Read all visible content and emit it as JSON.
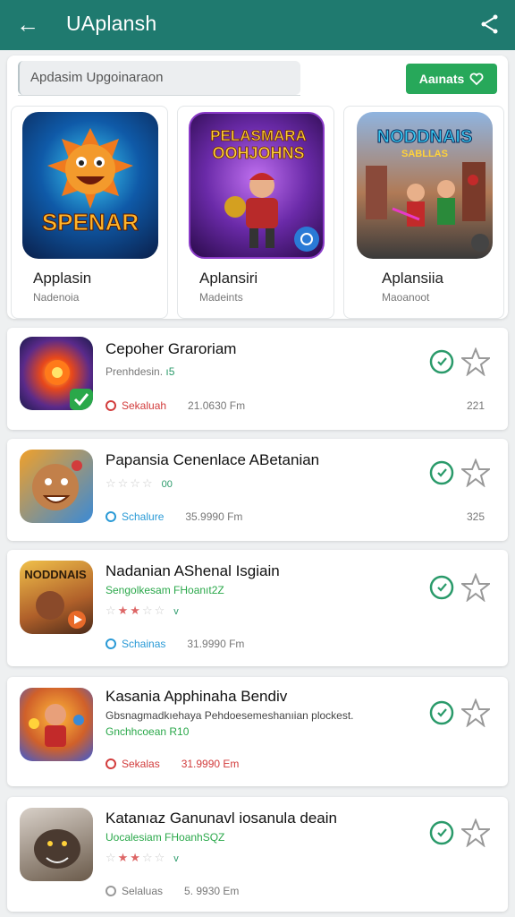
{
  "header": {
    "title": "UAplansh",
    "back_icon": "arrow-left-icon",
    "menu_icon": "share-network-icon"
  },
  "search": {
    "placeholder": "Apdasim Upgoinaraon"
  },
  "action_button": {
    "label": "Aaınats",
    "icon": "heart-icon"
  },
  "featured": [
    {
      "name": "Applasin",
      "sub": "Nadenoia",
      "art_text": "SPENAR"
    },
    {
      "name": "Aplansiri",
      "sub": "Madeints",
      "art_text": "PELASMARA OOHJOHNS"
    },
    {
      "name": "Aplansiia",
      "sub": "Maoanoot",
      "art_text": "NODDNAIS"
    }
  ],
  "list": [
    {
      "title": "Cepoher Graroriam",
      "sub": "Prenhdesin.",
      "sub_value": "ı5",
      "status": "Sekaluah",
      "status_color": "#d23c3c",
      "time": "21.0630 Fm",
      "count": "221",
      "badge": "check"
    },
    {
      "title": "Papansia Cenenlace ABetanian",
      "stars_tail": "00",
      "status": "Schalure",
      "status_color": "#2a9ad6",
      "time": "35.9990 Fm",
      "count": "325"
    },
    {
      "title": "Nadanian AShenal Isgiain",
      "sub": "Sengolkesam FHoanıt2Z",
      "stars_tail": "v",
      "status": "Schainas",
      "status_color": "#2a9ad6",
      "time": "31.9990 Fm",
      "count": ""
    },
    {
      "title": "Kasania Apphinaha Bendiv",
      "sub": "Gbsnagmadkıehaya Pehdoesemeshanıian plockest.",
      "sub2": "Gnchhcoean R10",
      "status": "Sekalas",
      "status_color": "#d23c3c",
      "time": "31.9990 Em",
      "count": ""
    },
    {
      "title": "Katanıaz Ganunavl iosanula deain",
      "sub": "Uocalesiam FHoanhSQZ",
      "stars_tail": "v",
      "status": "Selaluas",
      "status_color": "#999999",
      "time": "5. 9930 Em",
      "count": ""
    }
  ]
}
